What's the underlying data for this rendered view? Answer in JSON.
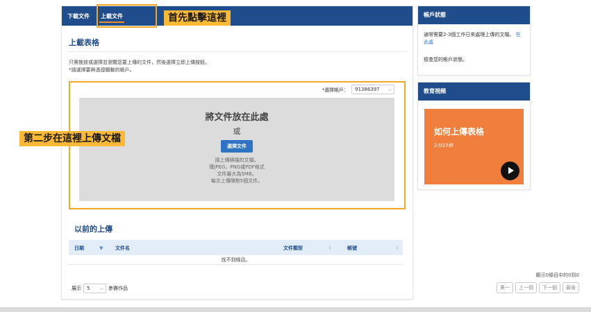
{
  "tabs": [
    {
      "label": "下載文件"
    },
    {
      "label": "上載文件"
    }
  ],
  "annotations": {
    "step1": "首先點擊這裡",
    "step2": "第二步在這裡上傳文檔"
  },
  "upload_form": {
    "title": "上載表格",
    "instruction_1": "只需拖放或選擇並瀏覽您要上傳的文件，然後選擇立即上傳按鈕。",
    "instruction_2": "*請選擇要與憑證關聯的帳戶。",
    "account_label": "*選擇帳戶：",
    "account_value": "91386397",
    "drop_title": "將文件放在此處",
    "drop_or": "或",
    "choose_button": "選擇文件",
    "note_1": "請上傳掃描的文檔。",
    "note_2": "僅JPEG，PNG或PDF格式",
    "note_3": "文件最大為5MB。",
    "note_4": "每次上傳限制5個文件。"
  },
  "previous_uploads": {
    "title": "以前的上傳",
    "columns": [
      "日期",
      "文件名",
      "文件類型",
      "帳號"
    ],
    "empty_text": "找不到條目。",
    "showing_text": "顯示0條目中的0到0",
    "pager": [
      "第一",
      "上一個",
      "下一個",
      "最後"
    ],
    "show_label": "展示",
    "page_size": "5",
    "page_size_suffix": "參賽作品"
  },
  "account_status": {
    "title": "帳戶狀態",
    "text_1": "通常需要2-3個工作日來處理上傳的文檔。",
    "link": "在此處",
    "text_2": "檢查您的帳戶狀態。"
  },
  "education_video": {
    "title": "教育視頻",
    "video_title": "如何上傳表格",
    "video_duration": "2分23秒"
  },
  "colors": {
    "primary": "#1f4d8b",
    "accent": "#f5a623",
    "video_bg": "#f07f3e"
  }
}
